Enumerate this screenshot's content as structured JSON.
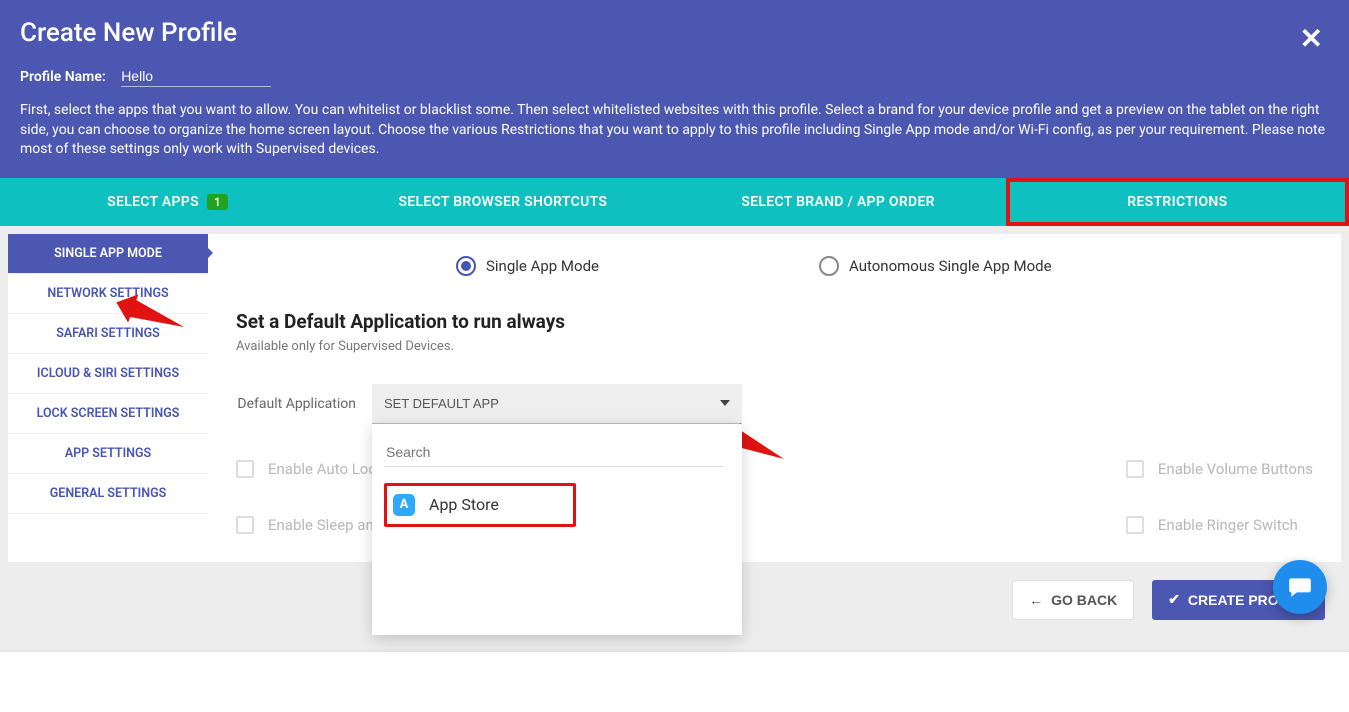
{
  "header": {
    "title": "Create New Profile",
    "profile_name_label": "Profile Name:",
    "profile_name_value": "Hello",
    "desc": "First, select the apps that you want to allow. You can whitelist or blacklist some. Then select whitelisted websites with this profile. Select a brand for your device profile and get a preview on the tablet on the right side, you can choose to organize the home screen layout. Choose the various Restrictions that you want to apply to this profile including Single App mode and/or Wi-Fi config, as per your requirement. Please note most of these settings only work with Supervised devices."
  },
  "tabs": [
    {
      "label": "SELECT APPS",
      "badge": "1"
    },
    {
      "label": "SELECT BROWSER SHORTCUTS"
    },
    {
      "label": "SELECT BRAND / APP ORDER"
    },
    {
      "label": "RESTRICTIONS"
    }
  ],
  "sidebar": {
    "items": [
      "SINGLE APP MODE",
      "NETWORK SETTINGS",
      "SAFARI SETTINGS",
      "ICLOUD & SIRI SETTINGS",
      "LOCK SCREEN SETTINGS",
      "APP SETTINGS",
      "GENERAL SETTINGS"
    ]
  },
  "content": {
    "radio1": "Single App Mode",
    "radio2": "Autonomous Single App Mode",
    "section_title": "Set a Default Application to run always",
    "section_sub": "Available only for Supervised Devices.",
    "default_app_label": "Default Application",
    "dd_placeholder": "SET DEFAULT APP",
    "search_placeholder": "Search",
    "dd_item_label": "App Store",
    "options": {
      "left": [
        "Enable Auto Lock",
        "Enable Sleep and Wake"
      ],
      "right": [
        "Enable Volume Buttons",
        "Enable Ringer Switch"
      ]
    }
  },
  "footer": {
    "back": "GO BACK",
    "create": "CREATE PROFILE"
  }
}
